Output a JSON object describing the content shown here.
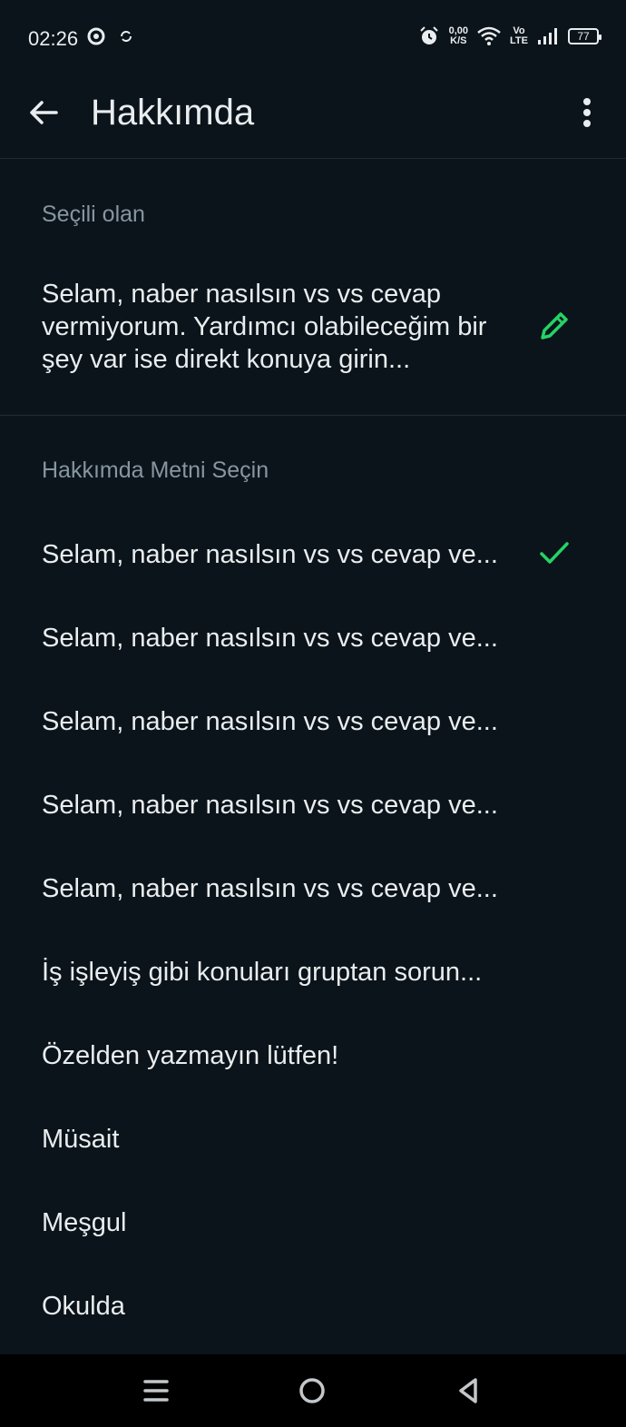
{
  "status_bar": {
    "time": "02:26",
    "speed_value": "0,00",
    "speed_unit": "K/S",
    "volte_top": "Vo",
    "volte_bottom": "LTE",
    "battery": "77",
    "icons": [
      "chrome-icon",
      "sync-icon",
      "alarm-icon",
      "wifi-icon",
      "signal-icon",
      "battery-icon"
    ]
  },
  "app_bar": {
    "title": "Hakkımda",
    "back_icon": "arrow-left-icon",
    "menu_icon": "more-vert-icon"
  },
  "current": {
    "label": "Seçili olan",
    "text": "Selam, naber nasılsın vs vs cevap vermiyorum. Yardımcı olabileceğim bir şey var ise direkt konuya girin...",
    "edit_icon": "pencil-icon"
  },
  "choose": {
    "label": "Hakkımda Metni Seçin",
    "items": [
      {
        "text": "Selam, naber nasılsın vs vs cevap ve...",
        "selected": true
      },
      {
        "text": "Selam, naber nasılsın vs vs cevap ve...",
        "selected": false
      },
      {
        "text": "Selam, naber nasılsın vs vs cevap ve...",
        "selected": false
      },
      {
        "text": "Selam, naber nasılsın vs vs cevap ve...",
        "selected": false
      },
      {
        "text": "Selam, naber nasılsın vs vs cevap ve...",
        "selected": false
      },
      {
        "text": "İş işleyiş gibi konuları gruptan sorun...",
        "selected": false
      },
      {
        "text": "Özelden yazmayın lütfen!",
        "selected": false
      },
      {
        "text": "Müsait",
        "selected": false
      },
      {
        "text": "Meşgul",
        "selected": false
      },
      {
        "text": "Okulda",
        "selected": false
      }
    ]
  },
  "colors": {
    "background": "#0b141a",
    "accent": "#25d366",
    "text_primary": "#e9edef",
    "text_secondary": "#8696a0"
  },
  "nav_bar": {
    "icons": [
      "menu-icon",
      "home-icon",
      "back-triangle-icon"
    ]
  }
}
